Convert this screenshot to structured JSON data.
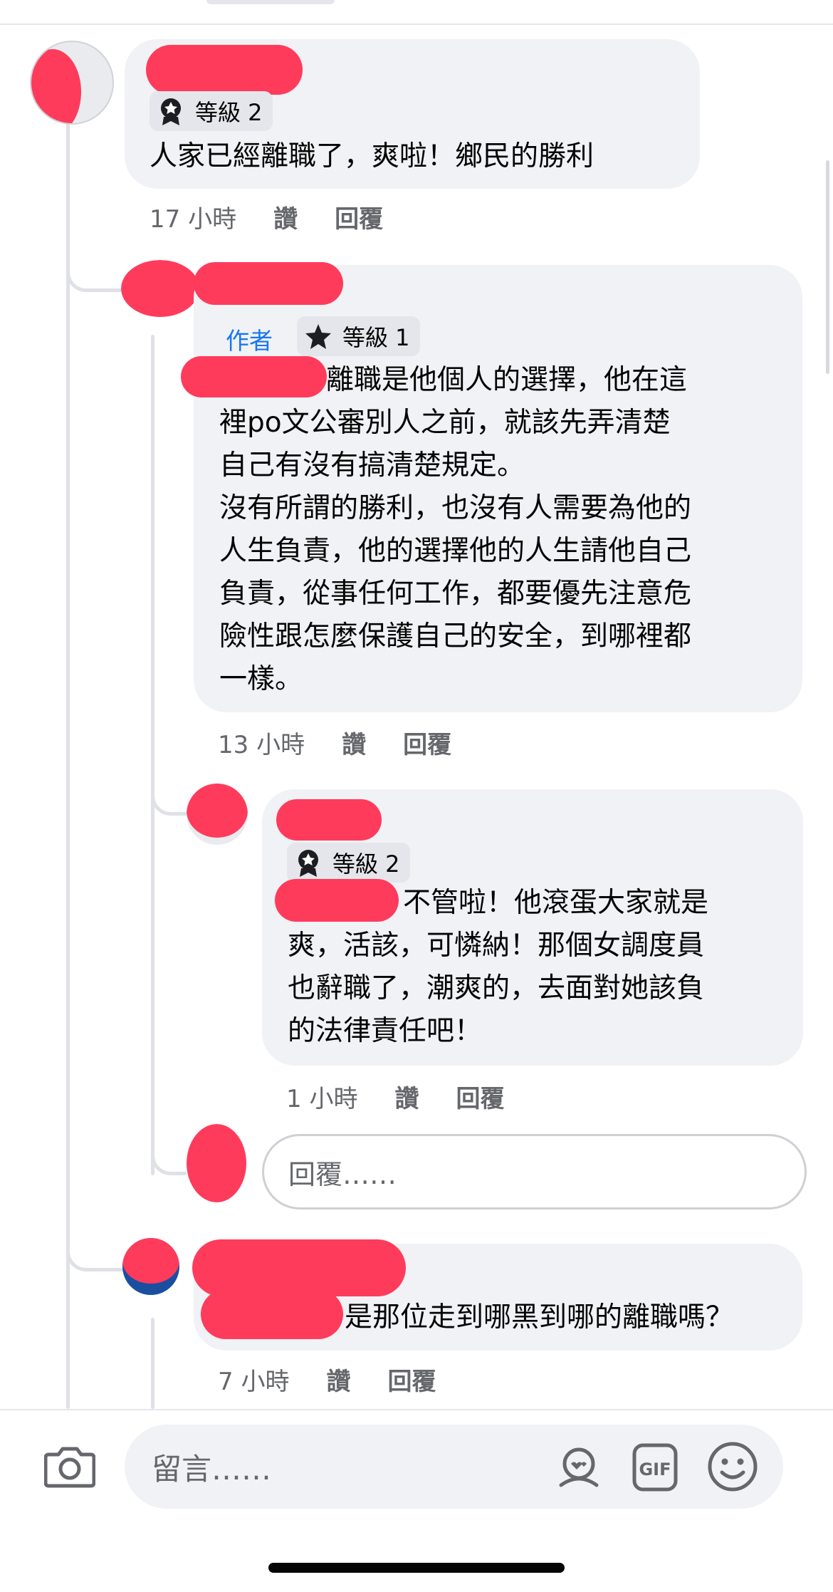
{
  "comments": [
    {
      "badge": "等級 2",
      "text": "人家已經離職了，爽啦！鄉民的勝利",
      "time": "17 小時",
      "like": "讚",
      "reply": "回覆"
    },
    {
      "author_tag": "作者",
      "badge": "等級 1",
      "text_lines": [
        "離職是他個人的選擇，他在這",
        "裡po文公審別人之前，就該先弄清楚",
        "自己有沒有搞清楚規定。",
        "沒有所謂的勝利，也沒有人需要為他的",
        "人生負責，他的選擇他的人生請他自己",
        "負責，從事任何工作，都要優先注意危",
        "險性跟怎麼保護自己的安全，到哪裡都",
        "一樣。"
      ],
      "time": "13 小時",
      "like": "讚",
      "reply": "回覆"
    },
    {
      "badge": "等級 2",
      "text_lines": [
        "不管啦！他滾蛋大家就是",
        "爽，活該，可憐納！那個女調度員",
        "也辭職了，潮爽的，去面對她該負",
        "的法律責任吧！"
      ],
      "time": "1 小時",
      "like": "讚",
      "reply": "回覆"
    },
    {
      "text": "是那位走到哪黑到哪的離職嗎？",
      "time": "7 小時",
      "like": "讚",
      "reply": "回覆"
    }
  ],
  "reply_input": {
    "placeholder": "回覆……"
  },
  "bottom_bar": {
    "placeholder": "留言……",
    "camera_icon": "camera-icon",
    "avatar_frame_icon": "avatar-sticker-icon",
    "gif_icon": "gif-icon",
    "emoji_icon": "emoji-icon"
  },
  "colors": {
    "bubble": "#f0f2f5",
    "meta": "#65676b",
    "author": "#1877f2",
    "redaction": "#ff3b5c"
  }
}
